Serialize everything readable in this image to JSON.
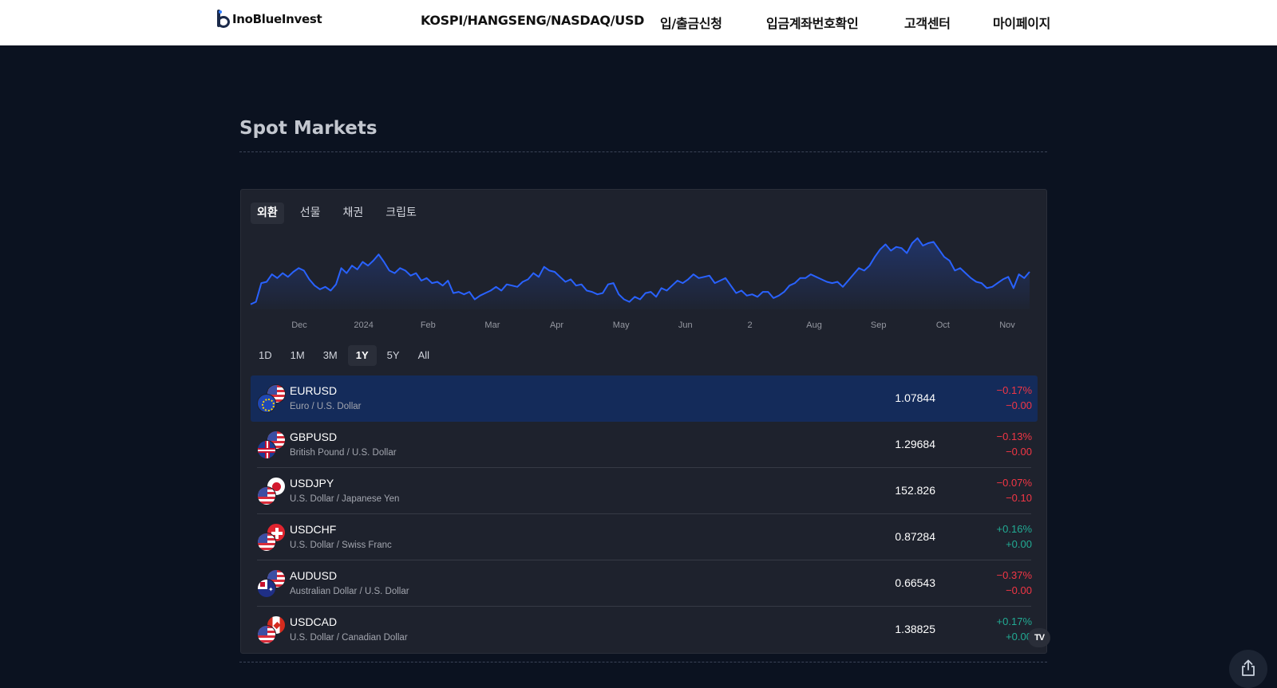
{
  "header": {
    "brand": "InoBlueInvest",
    "nav": [
      "KOSPI/HANGSENG/NASDAQ/USD",
      "입/출금신청",
      "입금계좌번호확인",
      "고객센터",
      "마이페이지"
    ]
  },
  "section": {
    "title": "Spot Markets"
  },
  "widget": {
    "tabs": [
      {
        "label": "외환",
        "active": true
      },
      {
        "label": "선물",
        "active": false
      },
      {
        "label": "채권",
        "active": false
      },
      {
        "label": "크립토",
        "active": false
      }
    ],
    "ranges": [
      {
        "label": "1D",
        "active": false
      },
      {
        "label": "1M",
        "active": false
      },
      {
        "label": "3M",
        "active": false
      },
      {
        "label": "1Y",
        "active": true
      },
      {
        "label": "5Y",
        "active": false
      },
      {
        "label": "All",
        "active": false
      }
    ],
    "rows": [
      {
        "symbol": "EURUSD",
        "desc": "Euro / U.S. Dollar",
        "price": "1.07844",
        "pct": "−0.17%",
        "chg": "−0.00",
        "dir": "neg",
        "flags": [
          "us",
          "eu"
        ],
        "selected": true
      },
      {
        "symbol": "GBPUSD",
        "desc": "British Pound / U.S. Dollar",
        "price": "1.29684",
        "pct": "−0.13%",
        "chg": "−0.00",
        "dir": "neg",
        "flags": [
          "us",
          "gb"
        ],
        "selected": false
      },
      {
        "symbol": "USDJPY",
        "desc": "U.S. Dollar / Japanese Yen",
        "price": "152.826",
        "pct": "−0.07%",
        "chg": "−0.10",
        "dir": "neg",
        "flags": [
          "jp",
          "us"
        ],
        "selected": false
      },
      {
        "symbol": "USDCHF",
        "desc": "U.S. Dollar / Swiss Franc",
        "price": "0.87284",
        "pct": "+0.16%",
        "chg": "+0.00",
        "dir": "pos",
        "flags": [
          "ch",
          "us"
        ],
        "selected": false
      },
      {
        "symbol": "AUDUSD",
        "desc": "Australian Dollar / U.S. Dollar",
        "price": "0.66543",
        "pct": "−0.37%",
        "chg": "−0.00",
        "dir": "neg",
        "flags": [
          "us",
          "au"
        ],
        "selected": false
      },
      {
        "symbol": "USDCAD",
        "desc": "U.S. Dollar / Canadian Dollar",
        "price": "1.38825",
        "pct": "+0.17%",
        "chg": "+0.00",
        "dir": "pos",
        "flags": [
          "ca",
          "us"
        ],
        "selected": false
      }
    ],
    "tv_badge": "TV"
  },
  "chart_data": {
    "type": "area",
    "x_ticks": [
      "Dec",
      "2024",
      "Feb",
      "Mar",
      "Apr",
      "May",
      "Jun",
      "2",
      "Aug",
      "Sep",
      "Oct",
      "Nov"
    ],
    "values": [
      1.062,
      1.064,
      1.079,
      1.08,
      1.086,
      1.083,
      1.087,
      1.084,
      1.088,
      1.091,
      1.089,
      1.082,
      1.077,
      1.074,
      1.076,
      1.073,
      1.078,
      1.091,
      1.087,
      1.093,
      1.09,
      1.096,
      1.093,
      1.097,
      1.102,
      1.096,
      1.089,
      1.087,
      1.091,
      1.089,
      1.085,
      1.087,
      1.081,
      1.083,
      1.079,
      1.08,
      1.077,
      1.081,
      1.071,
      1.072,
      1.07,
      1.072,
      1.066,
      1.069,
      1.071,
      1.073,
      1.076,
      1.073,
      1.078,
      1.077,
      1.076,
      1.08,
      1.082,
      1.087,
      1.084,
      1.092,
      1.089,
      1.088,
      1.084,
      1.08,
      1.082,
      1.077,
      1.078,
      1.073,
      1.072,
      1.07,
      1.071,
      1.078,
      1.079,
      1.07,
      1.066,
      1.064,
      1.068,
      1.066,
      1.071,
      1.072,
      1.068,
      1.075,
      1.073,
      1.077,
      1.081,
      1.079,
      1.082,
      1.086,
      1.083,
      1.084,
      1.085,
      1.079,
      1.081,
      1.083,
      1.077,
      1.071,
      1.073,
      1.069,
      1.07,
      1.068,
      1.072,
      1.072,
      1.067,
      1.069,
      1.072,
      1.077,
      1.079,
      1.083,
      1.083,
      1.086,
      1.084,
      1.082,
      1.08,
      1.079,
      1.08,
      1.076,
      1.081,
      1.086,
      1.091,
      1.089,
      1.093,
      1.1,
      1.106,
      1.11,
      1.105,
      1.108,
      1.107,
      1.103,
      1.111,
      1.115,
      1.109,
      1.111,
      1.112,
      1.106,
      1.1,
      1.097,
      1.089,
      1.091,
      1.087,
      1.083,
      1.08,
      1.079,
      1.075,
      1.076,
      1.079,
      1.082,
      1.084,
      1.075,
      1.086,
      1.083,
      1.088
    ],
    "ylim": [
      1.058,
      1.118
    ],
    "line_color": "#2962ff",
    "grid": false
  },
  "colors": {
    "page_bg": "#0b1220",
    "widget_bg": "#1e222d",
    "selected_row": "#142b5a",
    "negative": "#f23645",
    "positive": "#22ab94"
  },
  "icons": {
    "share": "share-icon",
    "tradingview": "tradingview-logo-icon"
  }
}
